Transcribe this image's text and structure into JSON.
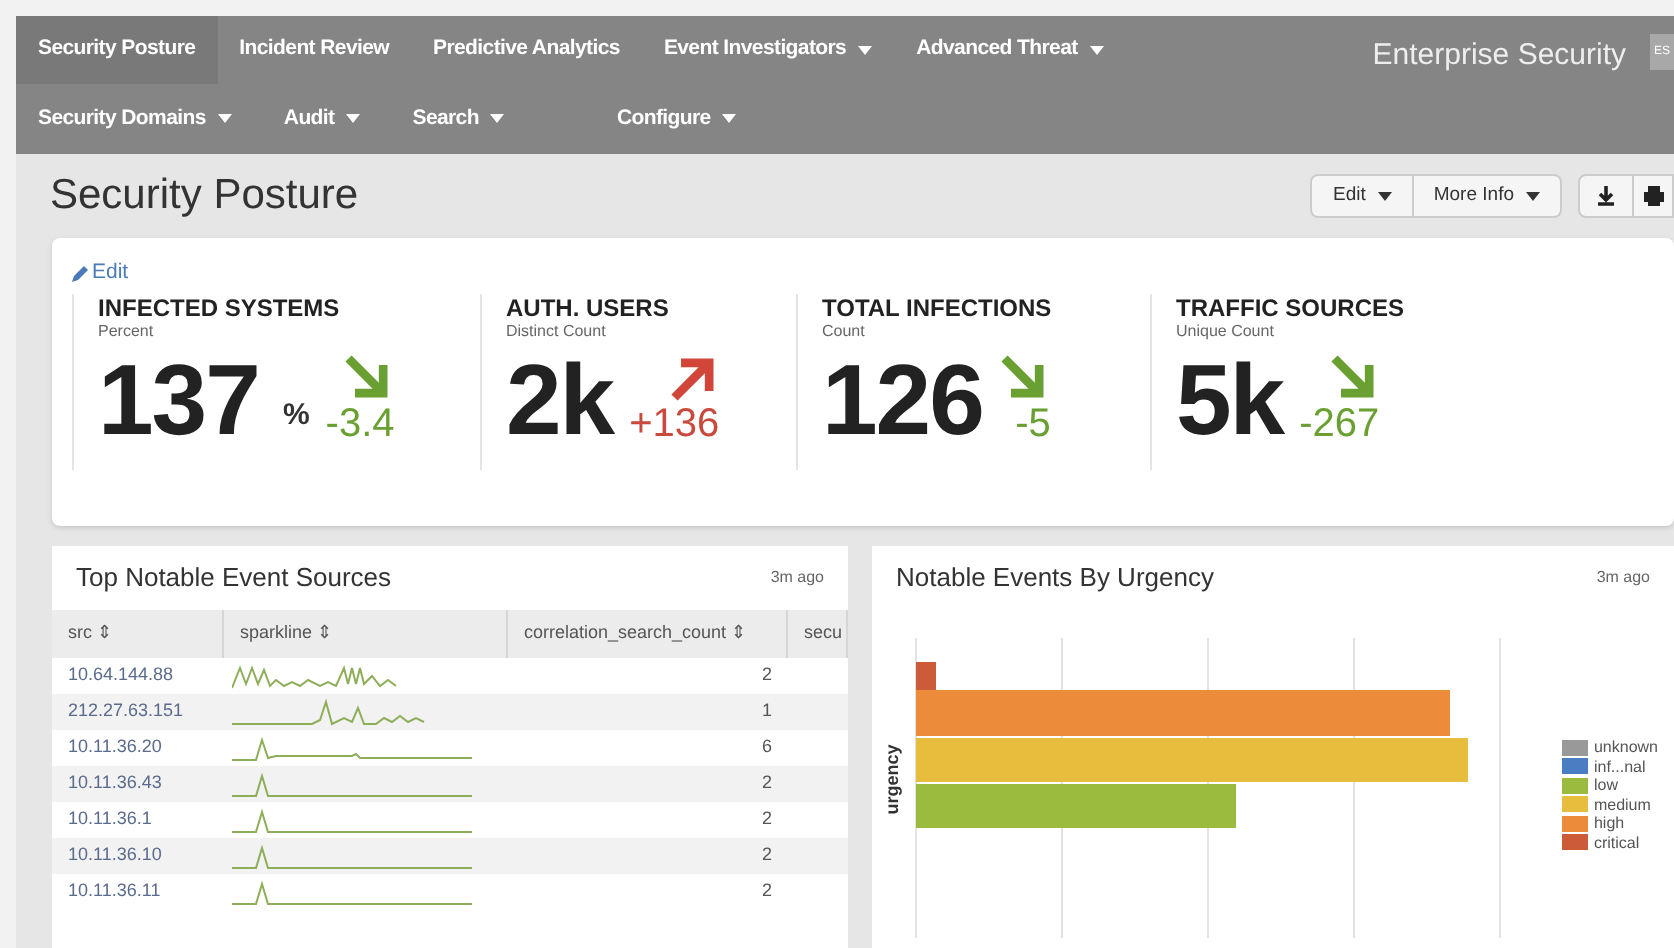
{
  "nav": {
    "rows": [
      [
        {
          "label": "Security Posture",
          "selected": true,
          "menu": false
        },
        {
          "label": "Incident Review",
          "selected": false,
          "menu": false
        },
        {
          "label": "Predictive Analytics",
          "selected": false,
          "menu": false
        },
        {
          "label": "Event Investigators",
          "selected": false,
          "menu": true
        },
        {
          "label": "Advanced Threat",
          "selected": false,
          "menu": true
        }
      ],
      [
        {
          "label": "Security Domains",
          "selected": false,
          "menu": true
        },
        {
          "label": "Audit",
          "selected": false,
          "menu": true
        },
        {
          "label": "Search",
          "selected": false,
          "menu": true
        },
        {
          "label": "Configure",
          "selected": false,
          "menu": true
        }
      ]
    ],
    "app_title": "Enterprise Security",
    "app_badge": "ES"
  },
  "page": {
    "title": "Security Posture",
    "buttons": [
      "Edit",
      "More Info"
    ]
  },
  "kpis": {
    "edit_link": "Edit",
    "items": [
      {
        "title": "INFECTED SYSTEMS",
        "subtitle": "Percent",
        "value": "137",
        "unit": "%",
        "delta": "-3.4",
        "rising": false
      },
      {
        "title": "AUTH. USERS",
        "subtitle": "Distinct Count",
        "value": "2k",
        "delta": "+136",
        "rising": true
      },
      {
        "title": "TOTAL INFECTIONS",
        "subtitle": "Count",
        "value": "126",
        "delta": "-5",
        "rising": false
      },
      {
        "title": "TRAFFIC SOURCES",
        "subtitle": "Unique Count",
        "value": "5k",
        "delta": "-267",
        "rising": false
      }
    ]
  },
  "table_panel": {
    "title": "Top Notable Event Sources",
    "updated": "3m ago",
    "columns": [
      "src ⇕",
      "sparkline ⇕",
      "correlation_search_count ⇕",
      "secu"
    ],
    "rows": [
      {
        "src": "10.64.144.88",
        "count": "2"
      },
      {
        "src": "212.27.63.151",
        "count": "1"
      },
      {
        "src": "10.11.36.20",
        "count": "6"
      },
      {
        "src": "10.11.36.43",
        "count": "2"
      },
      {
        "src": "10.11.36.1",
        "count": "2"
      },
      {
        "src": "10.11.36.10",
        "count": "2"
      },
      {
        "src": "10.11.36.11",
        "count": "2"
      }
    ]
  },
  "chart_panel": {
    "title": "Notable Events By Urgency",
    "updated": "3m ago",
    "ylabel": "urgency",
    "legend": [
      {
        "label": "unknown",
        "color": "#999999"
      },
      {
        "label": "inf...nal",
        "color": "#4a7ec2"
      },
      {
        "label": "low",
        "color": "#9bbb3e"
      },
      {
        "label": "medium",
        "color": "#e6bd3c"
      },
      {
        "label": "high",
        "color": "#ec8c3a"
      },
      {
        "label": "critical",
        "color": "#cc5b3a"
      }
    ]
  }
}
